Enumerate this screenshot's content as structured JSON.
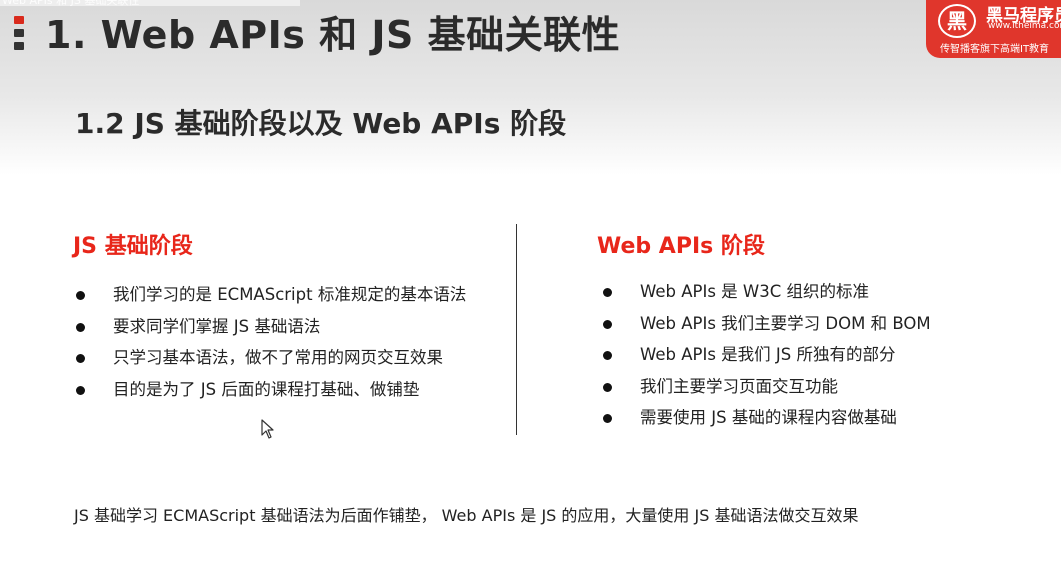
{
  "slide": {
    "top_strip_text": "Web APIs 和 JS 基础关联性",
    "title": "1. Web APIs 和 JS 基础关联性",
    "subtitle": "1.2 JS 基础阶段以及 Web APIs 阶段",
    "logo": {
      "name": "黑马程序员",
      "url": "www.itheima.com",
      "slogan": "传智播客旗下高端IT教育",
      "circle_glyph": "黑"
    },
    "left_column": {
      "heading": "JS 基础阶段",
      "items": [
        "我们学习的是 ECMAScript 标准规定的基本语法",
        "要求同学们掌握 JS 基础语法",
        "只学习基本语法，做不了常用的网页交互效果",
        "目的是为了 JS 后面的课程打基础、做铺垫"
      ]
    },
    "right_column": {
      "heading": "Web APIs 阶段",
      "items": [
        "Web APIs 是 W3C 组织的标准",
        "Web APIs 我们主要学习 DOM 和 BOM",
        "Web APIs 是我们 JS 所独有的部分",
        "我们主要学习页面交互功能",
        "需要使用 JS 基础的课程内容做基础"
      ]
    },
    "footer": "JS 基础学习 ECMAScript 基础语法为后面作铺垫， Web APIs 是 JS 的应用，大量使用 JS 基础语法做交互效果"
  },
  "colors": {
    "accent_red": "#e8261a",
    "title_text": "#2b2b2b",
    "logo_bg": "#e0362c"
  }
}
